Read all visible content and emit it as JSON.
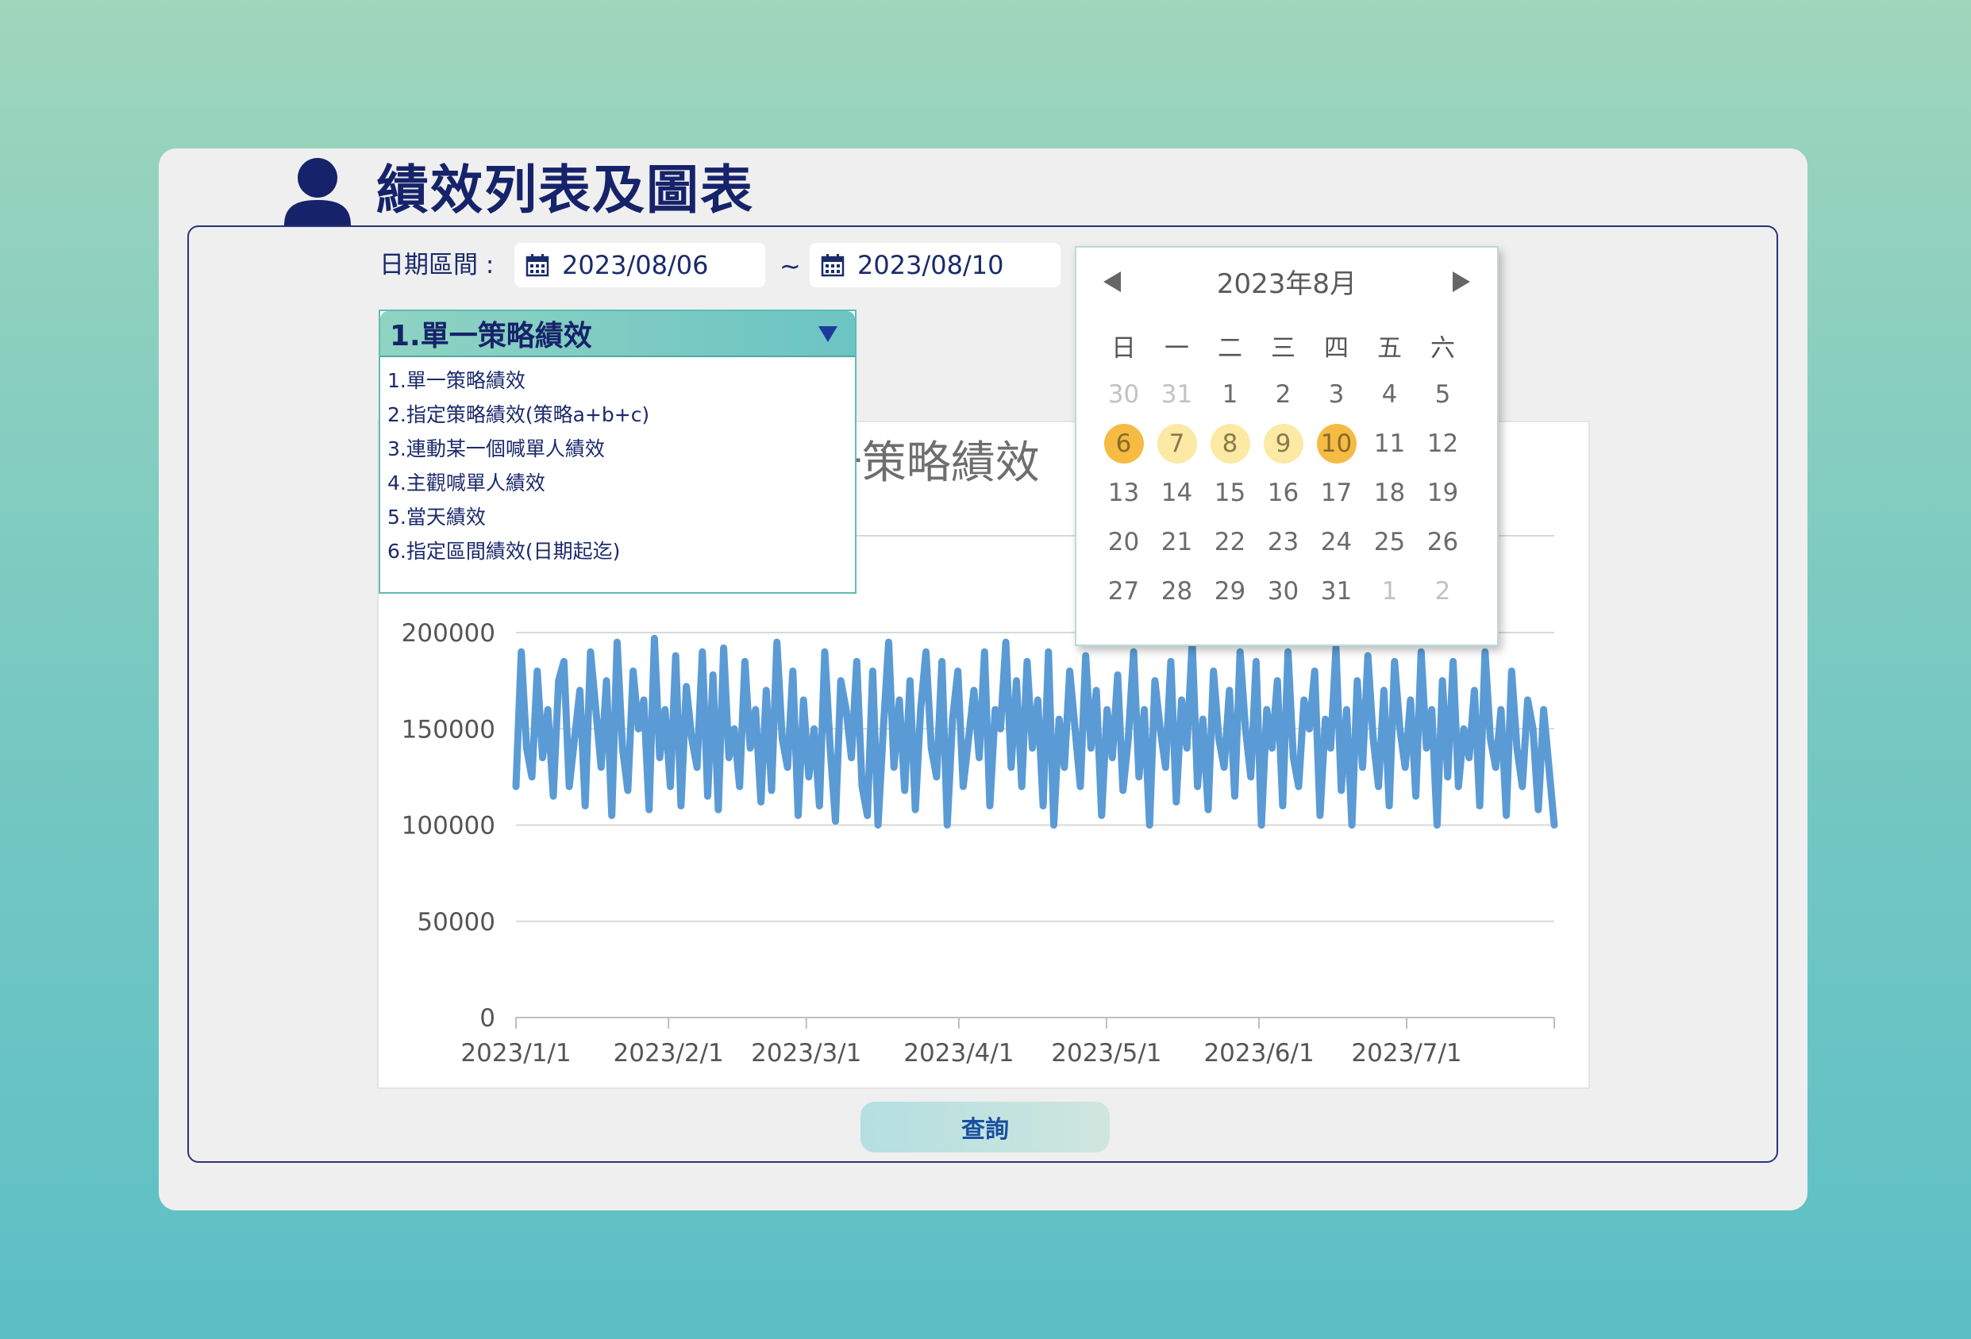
{
  "header": {
    "title": "績效列表及圖表"
  },
  "filters": {
    "date_label": "日期區間 :",
    "start_date": "2023/08/06",
    "separator": "~",
    "end_date": "2023/08/10"
  },
  "strategy_select": {
    "selected": "1.單一策略績效",
    "options": [
      "1.單一策略績效",
      "2.指定策略績效(策略a+b+c)",
      "3.連動某一個喊單人績效",
      "4.主觀喊單人績效",
      "5.當天績效",
      "6.指定區間績效(日期起迄)"
    ]
  },
  "calendar": {
    "title": "2023年8月",
    "weekdays": [
      "日",
      "一",
      "二",
      "三",
      "四",
      "五",
      "六"
    ],
    "weeks": [
      [
        "30",
        "31",
        "1",
        "2",
        "3",
        "4",
        "5"
      ],
      [
        "6",
        "7",
        "8",
        "9",
        "10",
        "11",
        "12"
      ],
      [
        "13",
        "14",
        "15",
        "16",
        "17",
        "18",
        "19"
      ],
      [
        "20",
        "21",
        "22",
        "23",
        "24",
        "25",
        "26"
      ],
      [
        "27",
        "28",
        "29",
        "30",
        "31",
        "1",
        "2"
      ]
    ],
    "colors": {
      "range_edge": "#f6bb42",
      "range_mid": "#fce9a3"
    }
  },
  "chart_data": {
    "type": "line",
    "title": "1.單一策略績效",
    "xlabel": "",
    "ylabel": "",
    "ylim": [
      0,
      200000
    ],
    "yticks": [
      0,
      50000,
      100000,
      150000,
      200000
    ],
    "xticks": [
      "2023/1/1",
      "2023/2/1",
      "2023/3/1",
      "2023/4/1",
      "2023/5/1",
      "2023/6/1",
      "2023/7/1"
    ],
    "grid": true,
    "series_color": "#5b9bd5",
    "series": [
      {
        "x_start": "2023/1/1",
        "x_end": "2023/7/31",
        "values": [
          120000,
          190000,
          140000,
          125000,
          180000,
          135000,
          160000,
          115000,
          175000,
          185000,
          120000,
          145000,
          170000,
          110000,
          190000,
          160000,
          130000,
          175000,
          105000,
          195000,
          140000,
          118000,
          180000,
          150000,
          165000,
          108000,
          197000,
          135000,
          160000,
          120000,
          188000,
          110000,
          172000,
          145000,
          130000,
          190000,
          115000,
          178000,
          108000,
          192000,
          135000,
          150000,
          120000,
          185000,
          140000,
          160000,
          112000,
          170000,
          118000,
          195000,
          145000,
          130000,
          180000,
          105000,
          165000,
          125000,
          150000,
          110000,
          190000,
          140000,
          102000,
          175000,
          160000,
          135000,
          185000,
          120000,
          105000,
          180000,
          100000,
          150000,
          195000,
          130000,
          165000,
          118000,
          175000,
          108000,
          160000,
          190000,
          140000,
          125000,
          185000,
          100000,
          155000,
          180000,
          120000,
          145000,
          170000,
          135000,
          190000,
          110000,
          160000,
          150000,
          195000,
          130000,
          175000,
          120000,
          185000,
          140000,
          165000,
          110000,
          190000,
          100000,
          155000,
          130000,
          180000,
          150000,
          120000,
          188000,
          140000,
          170000,
          105000,
          160000,
          135000,
          178000,
          118000,
          145000,
          190000,
          125000,
          160000,
          100000,
          175000,
          150000,
          130000,
          185000,
          112000,
          165000,
          140000,
          195000,
          120000,
          155000,
          108000,
          180000,
          145000,
          130000,
          170000,
          115000,
          190000,
          150000,
          125000,
          185000,
          100000,
          160000,
          140000,
          175000,
          110000,
          190000,
          135000,
          120000,
          165000,
          150000,
          180000,
          105000,
          155000,
          140000,
          192000,
          118000,
          160000,
          100000,
          175000,
          130000,
          188000,
          145000,
          120000,
          170000,
          110000,
          185000,
          150000,
          130000,
          165000,
          115000,
          190000,
          140000,
          160000,
          100000,
          175000,
          125000,
          185000,
          120000,
          150000,
          135000,
          170000,
          110000,
          190000,
          145000,
          130000,
          160000,
          105000,
          180000,
          140000,
          120000,
          165000,
          150000,
          108000,
          160000,
          130000,
          100000
        ]
      }
    ]
  },
  "query_button": {
    "label": "查詢"
  }
}
